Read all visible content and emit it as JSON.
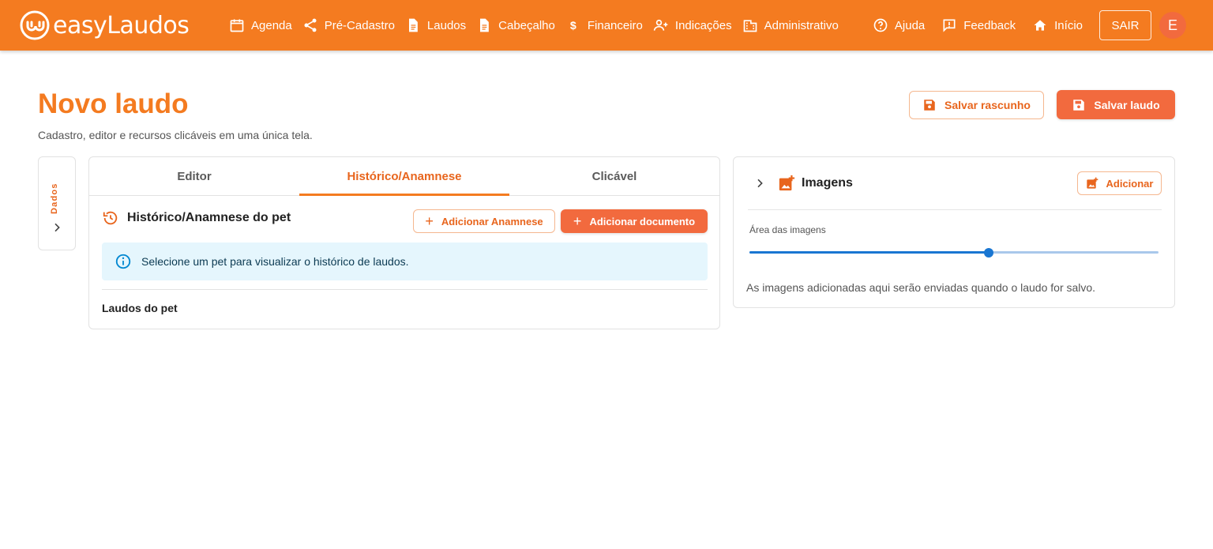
{
  "brand": {
    "name": "easyLaudos"
  },
  "colors": {
    "primary": "#f47b20",
    "accent": "#f26a3e",
    "info_bg": "#e5f6fd",
    "slider": "#1976d2"
  },
  "nav": {
    "items": [
      {
        "label": "Agenda",
        "icon": "calendar-icon"
      },
      {
        "label": "Pré-Cadastro",
        "icon": "share-icon"
      },
      {
        "label": "Laudos",
        "icon": "document-icon"
      },
      {
        "label": "Cabeçalho",
        "icon": "document-icon"
      },
      {
        "label": "Financeiro",
        "icon": "dollar-icon"
      },
      {
        "label": "Indicações",
        "icon": "person-add-icon"
      },
      {
        "label": "Administrativo",
        "icon": "building-icon"
      }
    ],
    "right": [
      {
        "label": "Ajuda",
        "icon": "help-icon"
      },
      {
        "label": "Feedback",
        "icon": "feedback-icon"
      },
      {
        "label": "Início",
        "icon": "home-icon"
      }
    ],
    "logout_label": "SAIR",
    "avatar_initial": "E"
  },
  "page": {
    "title": "Novo laudo",
    "subtitle": "Cadastro, editor e recursos clicáveis em uma única tela.",
    "save_draft_label": "Salvar rascunho",
    "save_label": "Salvar laudo"
  },
  "side": {
    "label": "Dados"
  },
  "tabs": [
    {
      "label": "Editor",
      "active": false
    },
    {
      "label": "Histórico/Anamnese",
      "active": true
    },
    {
      "label": "Clicável",
      "active": false
    }
  ],
  "history": {
    "title": "Histórico/Anamnese do pet",
    "add_anamnese_label": "Adicionar Anamnese",
    "add_document_label": "Adicionar documento",
    "info": "Selecione um pet para visualizar o histórico de laudos.",
    "laudos_label": "Laudos do pet"
  },
  "images": {
    "title": "Imagens",
    "add_label": "Adicionar",
    "slider_label": "Área das imagens",
    "slider_value": 0.585,
    "note": "As imagens adicionadas aqui serão enviadas quando o laudo for salvo."
  }
}
